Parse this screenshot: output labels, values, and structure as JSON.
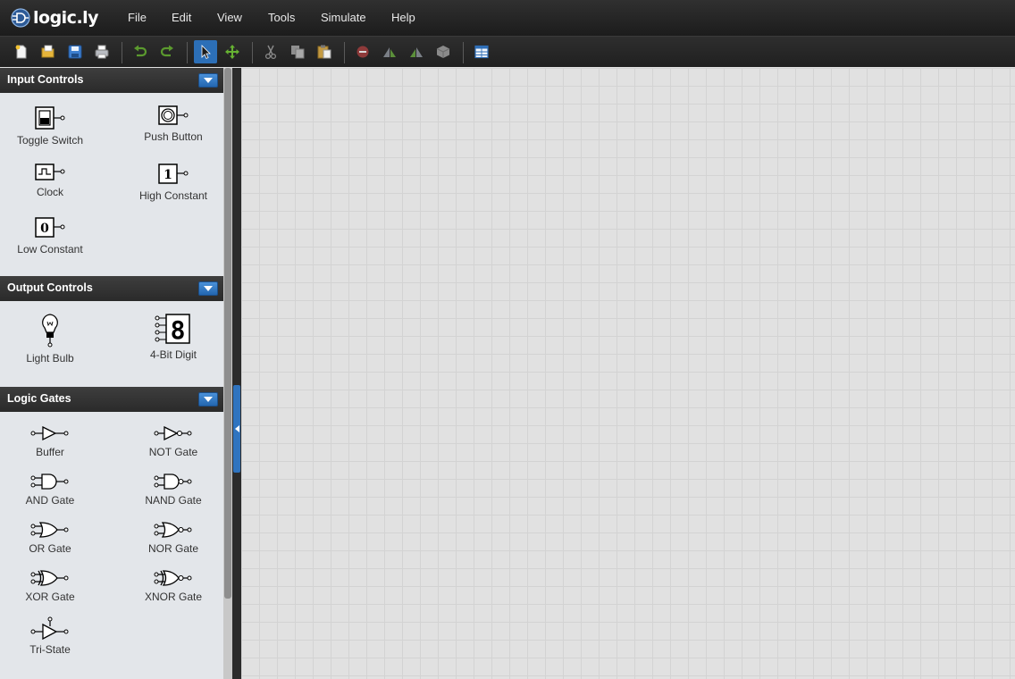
{
  "app": {
    "logo_text": "logic.ly"
  },
  "menu": [
    "File",
    "Edit",
    "View",
    "Tools",
    "Simulate",
    "Help"
  ],
  "toolbar": {
    "buttons": [
      "new-icon",
      "open-icon",
      "save-icon",
      "print-icon",
      "undo-icon",
      "redo-icon",
      "select-tool-icon",
      "pan-tool-icon",
      "cut-icon",
      "copy-icon",
      "paste-icon",
      "delete-icon",
      "rotate-left-icon",
      "rotate-right-icon",
      "group-icon",
      "truth-table-icon"
    ],
    "active": "select-tool-icon",
    "accent": "#2c6fb7"
  },
  "sidebar": {
    "sections": [
      {
        "title": "Input Controls",
        "items": [
          "Toggle Switch",
          "Push Button",
          "Clock",
          "High Constant",
          "Low Constant"
        ]
      },
      {
        "title": "Output Controls",
        "items": [
          "Light Bulb",
          "4-Bit Digit"
        ]
      },
      {
        "title": "Logic Gates",
        "items": [
          "Buffer",
          "NOT Gate",
          "AND Gate",
          "NAND Gate",
          "OR Gate",
          "NOR Gate",
          "XOR Gate",
          "XNOR Gate",
          "Tri-State"
        ]
      }
    ],
    "constants": {
      "high": "1",
      "low": "0",
      "digit": "8"
    }
  }
}
